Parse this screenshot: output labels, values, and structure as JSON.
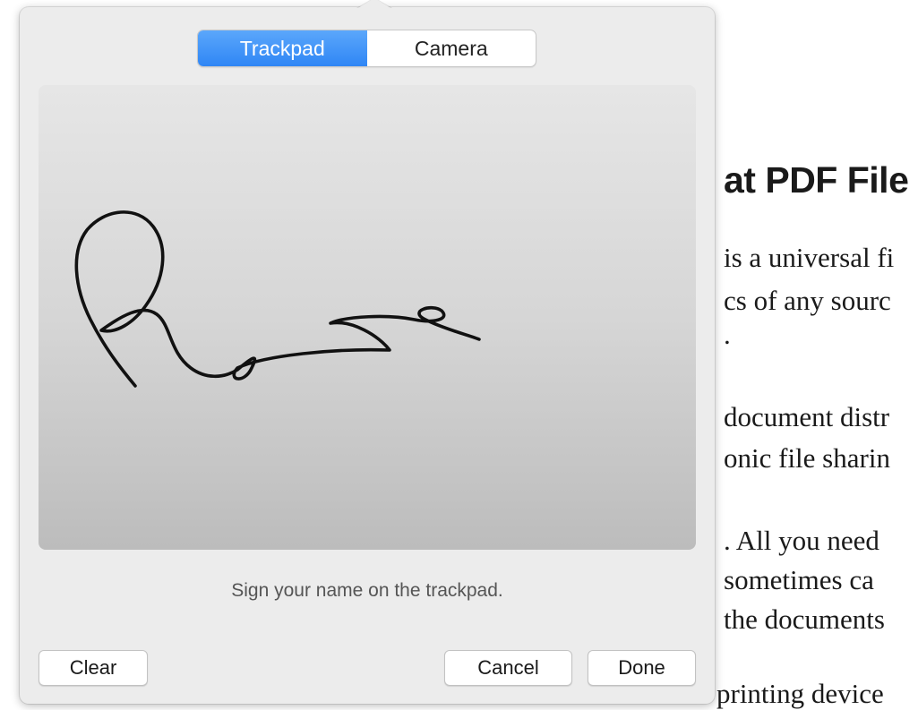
{
  "popover": {
    "tabs": [
      {
        "label": "Trackpad",
        "active": true
      },
      {
        "label": "Camera",
        "active": false
      }
    ],
    "hint": "Sign your name on the trackpad.",
    "buttons": {
      "clear": "Clear",
      "cancel": "Cancel",
      "done": "Done"
    }
  },
  "document": {
    "heading": "at PDF File",
    "lines": [
      "is a universal fi",
      "cs of any sourc",
      ".",
      "document distr",
      "onic file sharin",
      ". All you need",
      "sometimes ca",
      "the documents",
      "printing device"
    ]
  },
  "colors": {
    "accent": "#2f86f5",
    "popover_bg": "#ececec"
  }
}
